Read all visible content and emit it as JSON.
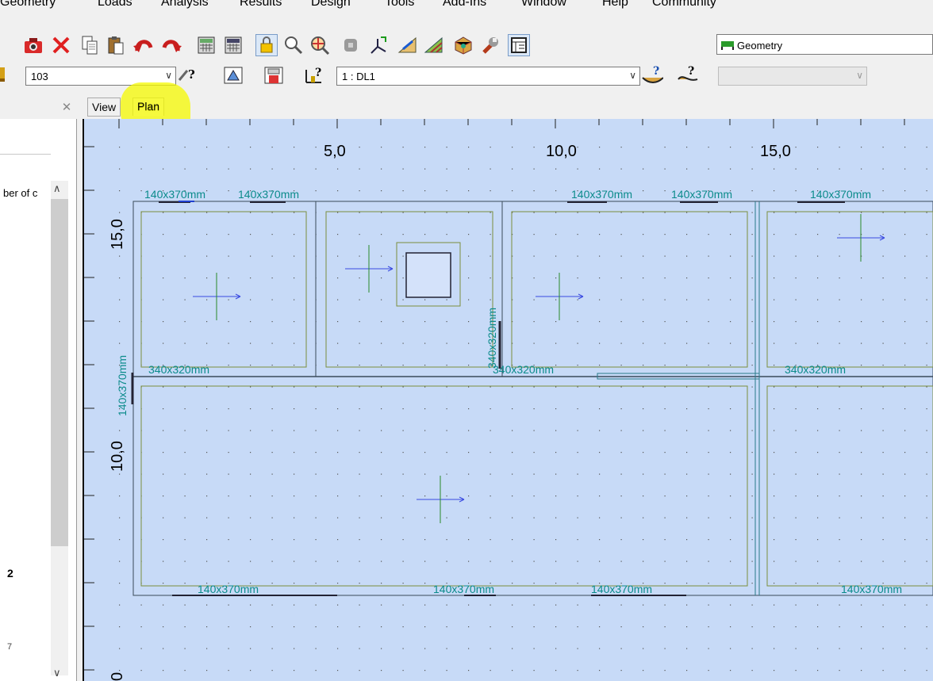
{
  "menu": [
    "Geometry",
    "Loads",
    "Analysis",
    "Results",
    "Design",
    "Tools",
    "Add-Ins",
    "Window",
    "Help",
    "Community"
  ],
  "toolbar": {
    "icons": [
      "camera-icon",
      "delete-icon",
      "copy-icon",
      "paste-icon",
      "undo-icon",
      "redo-icon",
      "calculator-icon",
      "calculator-2-icon",
      "lock-icon",
      "zoom-icon",
      "zoom-target-icon",
      "tool-gray-icon",
      "load-icon",
      "ruler-icon",
      "mesh-icon",
      "3d-icon",
      "wrench-icon",
      "table-icon"
    ],
    "geometry_combo": "Geometry"
  },
  "toolbar2": {
    "node_value": "103",
    "load_case": "1 : DL1",
    "third_combo": ""
  },
  "left_panel": {
    "header": "ber of c",
    "value_a": "2",
    "value_b": "7"
  },
  "tabs": {
    "view": "View",
    "plan": "Plan"
  },
  "plan": {
    "axis_x": [
      "5,0",
      "10,0",
      "15,0"
    ],
    "axis_y": [
      "15,0",
      "10,0",
      "0"
    ],
    "beam_top": [
      "140x370mm",
      "140x370mm",
      "140x370mm",
      "140x370mm",
      "140x370mm"
    ],
    "beam_mid": [
      "340x320mm",
      "340x320mm",
      "340x320mm"
    ],
    "beam_bottom": [
      "140x370mm",
      "140x370mm",
      "140x370mm",
      "140x370mm"
    ],
    "beam_vertical_left": "140x370mm",
    "beam_vertical_mid": "340x320mm"
  },
  "colors": {
    "canvas_bg": "#c7daf7",
    "slab_outline": "#7b8f3c",
    "label_teal": "#0b8b8b",
    "highlight": "#f5fa00"
  }
}
